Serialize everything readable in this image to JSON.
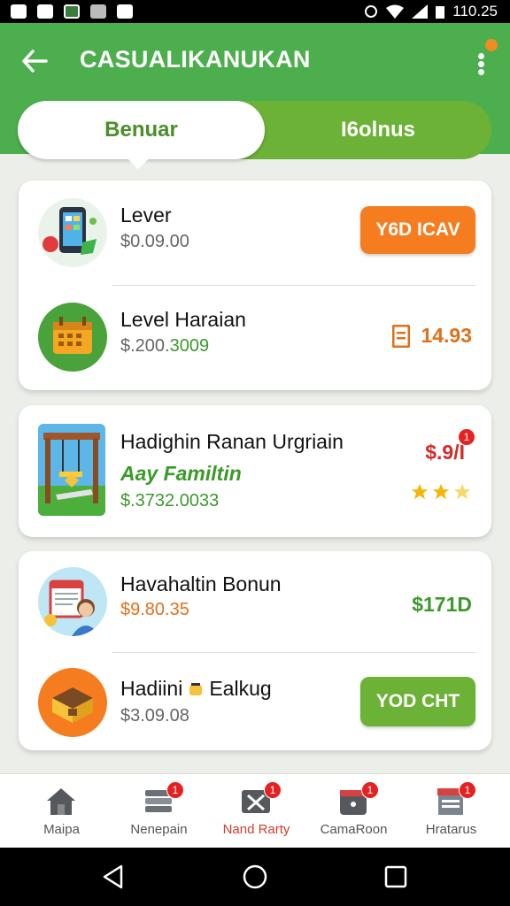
{
  "status_bar": {
    "time": "110.25"
  },
  "app_bar": {
    "title": "CASUALIKANUKAN",
    "menu_badge": ""
  },
  "tabs": [
    {
      "label": "Benuar",
      "active": true
    },
    {
      "label": "I6olnus",
      "active": false
    }
  ],
  "cards": [
    {
      "rows": [
        {
          "icon": "phone-games-icon",
          "title": "Lever",
          "subtitle": "$0.09.00",
          "action": {
            "type": "button",
            "label": "Y6D ICAV",
            "color": "#f57d1f"
          }
        },
        {
          "icon": "calendar-basket-icon",
          "title": "Level Haraian",
          "subtitle_prefix": "$.200.",
          "subtitle_highlight": "3009",
          "action": {
            "type": "price",
            "label": "14.93",
            "icon": "receipt-icon",
            "color": "#e0701a"
          }
        }
      ]
    },
    {
      "rows": [
        {
          "icon": "playground-icon",
          "title": "Hadighin Ranan Urgriain",
          "green_text": "Aay  Familtin",
          "subtitle": "$.3732.0033",
          "action": {
            "type": "price",
            "label": "$.9/I",
            "color": "#d42a2a",
            "badge": "1",
            "stars": 3
          }
        }
      ]
    },
    {
      "rows": [
        {
          "icon": "person-calendar-icon",
          "title": "Havahaltin Bonun",
          "subtitle": "$9.80.35",
          "subtitle_color": "#e0701a",
          "action": {
            "type": "price",
            "label": "$171D",
            "color": "#3a9a2a"
          }
        },
        {
          "icon": "treasure-box-icon",
          "title": "Hadiini",
          "title_suffix": "Ealkug",
          "subtitle": "$3.09.08",
          "action": {
            "type": "button",
            "label": "YOD CHT",
            "color": "#6cb236"
          }
        }
      ]
    }
  ],
  "bottom_nav": [
    {
      "label": "Maipa",
      "icon": "home-icon",
      "badge": ""
    },
    {
      "label": "Nenepain",
      "icon": "stack-icon",
      "badge": "1"
    },
    {
      "label": "Nand Rarty",
      "icon": "envelope-icon",
      "badge": "1",
      "active": true
    },
    {
      "label": "CamaRoon",
      "icon": "dice-icon",
      "badge": "1"
    },
    {
      "label": "Hratarus",
      "icon": "store-icon",
      "badge": "1"
    }
  ]
}
